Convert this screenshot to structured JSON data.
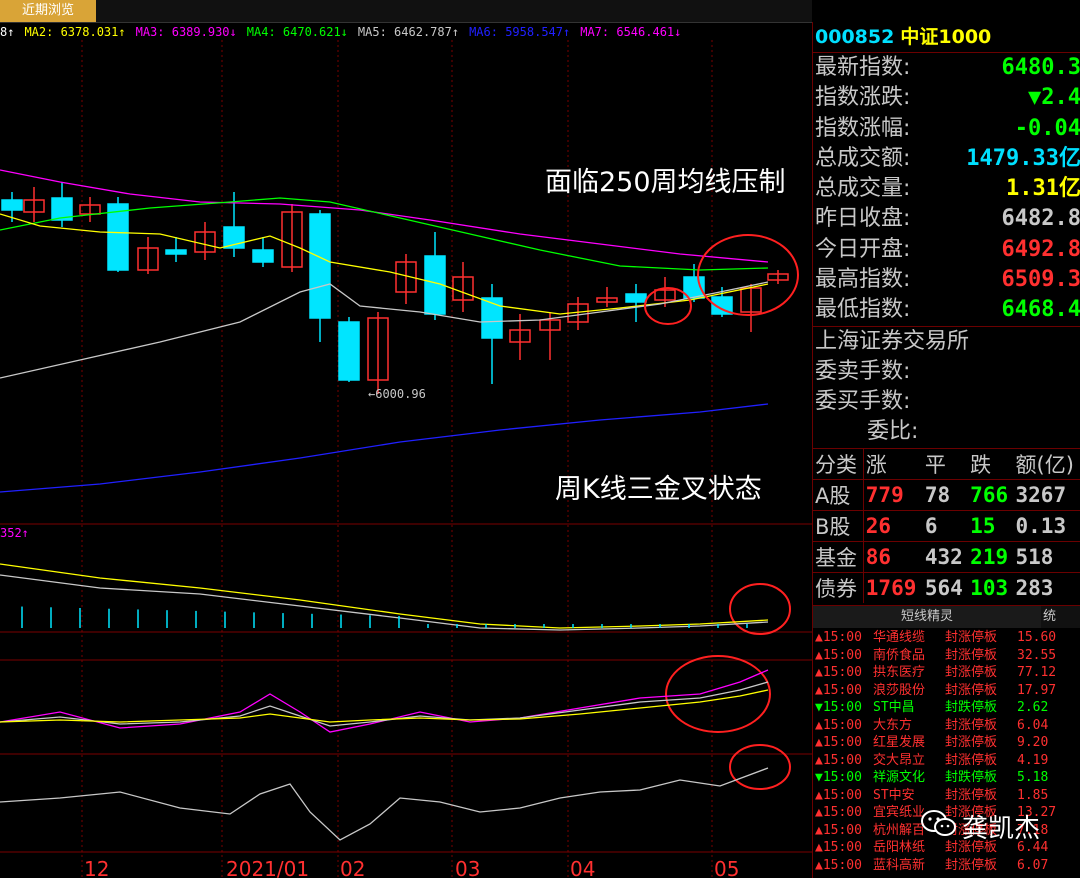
{
  "tab": {
    "label": "近期浏览"
  },
  "ma_items": [
    {
      "label": "8↑",
      "color": "#ffffff"
    },
    {
      "label": "MA2: 6378.031↑",
      "color": "#ffff00"
    },
    {
      "label": "MA3: 6389.930↓",
      "color": "#ff00ff"
    },
    {
      "label": "MA4: 6470.621↓",
      "color": "#00ff00"
    },
    {
      "label": "MA5: 6462.787↑",
      "color": "#c8c8c8"
    },
    {
      "label": "MA6: 5958.547↑",
      "color": "#2020ff"
    },
    {
      "label": "MA7: 6546.461↓",
      "color": "#ff00ff"
    }
  ],
  "annotations": {
    "top_text": "面临250周均线压制",
    "mid_text": "周K线三金叉状态",
    "low_label": "←6000.96",
    "indicator_label": "352↑"
  },
  "x_axis_labels": [
    "12",
    "2021/01",
    "02",
    "03",
    "04",
    "05"
  ],
  "stock": {
    "code": "000852",
    "name": "中证1000"
  },
  "quotes": [
    {
      "label": "最新指数:",
      "value": "6480.3",
      "color": "#00ff00"
    },
    {
      "label": "指数涨跌:",
      "value": "▼2.4",
      "color": "#00ff00"
    },
    {
      "label": "指数涨幅:",
      "value": "-0.04",
      "color": "#00ff00"
    },
    {
      "label": "总成交额:",
      "value": "1479.33亿",
      "color": "#00e0ff"
    },
    {
      "label": "总成交量:",
      "value": "1.31亿",
      "color": "#ffff00"
    },
    {
      "label": "昨日收盘:",
      "value": "6482.8",
      "color": "#c8c8c8"
    },
    {
      "label": "今日开盘:",
      "value": "6492.8",
      "color": "#ff3030"
    },
    {
      "label": "最高指数:",
      "value": "6509.3",
      "color": "#ff3030"
    },
    {
      "label": "最低指数:",
      "value": "6468.4",
      "color": "#00ff00"
    }
  ],
  "exchange": "上海证券交易所",
  "order_rows": [
    {
      "label": "委卖手数:"
    },
    {
      "label": "委买手数:"
    },
    {
      "label": "委比:"
    }
  ],
  "stat_table": {
    "headers": [
      "分类",
      "涨",
      "平",
      "跌",
      "额(亿)"
    ],
    "rows": [
      {
        "name": "A股",
        "up": "779",
        "flat": "78",
        "down": "766",
        "amt": "3267"
      },
      {
        "name": "B股",
        "up": "26",
        "flat": "6",
        "down": "15",
        "amt": "0.13"
      },
      {
        "name": "基金",
        "up": "86",
        "flat": "432",
        "down": "219",
        "amt": "518"
      },
      {
        "name": "债券",
        "up": "1769",
        "flat": "564",
        "down": "103",
        "amt": "283"
      }
    ]
  },
  "sprite": {
    "tab_label": "短线精灵",
    "tab2_label": "统",
    "items": [
      {
        "dir": "▲",
        "time": "15:00",
        "name": "华通线缆",
        "event": "封涨停板",
        "price": "15.60",
        "up": true
      },
      {
        "dir": "▲",
        "time": "15:00",
        "name": "南侨食品",
        "event": "封涨停板",
        "price": "32.55",
        "up": true
      },
      {
        "dir": "▲",
        "time": "15:00",
        "name": "拱东医疗",
        "event": "封涨停板",
        "price": "77.12",
        "up": true
      },
      {
        "dir": "▲",
        "time": "15:00",
        "name": "浪莎股份",
        "event": "封涨停板",
        "price": "17.97",
        "up": true
      },
      {
        "dir": "▼",
        "time": "15:00",
        "name": "ST中昌",
        "event": "封跌停板",
        "price": "2.62",
        "up": false
      },
      {
        "dir": "▲",
        "time": "15:00",
        "name": "大东方",
        "event": "封涨停板",
        "price": "6.04",
        "up": true
      },
      {
        "dir": "▲",
        "time": "15:00",
        "name": "红星发展",
        "event": "封涨停板",
        "price": "9.20",
        "up": true
      },
      {
        "dir": "▲",
        "time": "15:00",
        "name": "交大昂立",
        "event": "封涨停板",
        "price": "4.19",
        "up": true
      },
      {
        "dir": "▼",
        "time": "15:00",
        "name": "祥源文化",
        "event": "封跌停板",
        "price": "5.18",
        "up": false
      },
      {
        "dir": "▲",
        "time": "15:00",
        "name": "ST中安",
        "event": "封涨停板",
        "price": "1.85",
        "up": true
      },
      {
        "dir": "▲",
        "time": "15:00",
        "name": "宜宾纸业",
        "event": "封涨停板",
        "price": "13.27",
        "up": true
      },
      {
        "dir": "▲",
        "time": "15:00",
        "name": "杭州解百",
        "event": "封涨停板",
        "price": "7.18",
        "up": true
      },
      {
        "dir": "▲",
        "time": "15:00",
        "name": "岳阳林纸",
        "event": "封涨停板",
        "price": "6.44",
        "up": true
      },
      {
        "dir": "▲",
        "time": "15:00",
        "name": "蓝科高新",
        "event": "封涨停板",
        "price": "6.07",
        "up": true
      }
    ]
  },
  "watermark": "龚凯杰"
}
